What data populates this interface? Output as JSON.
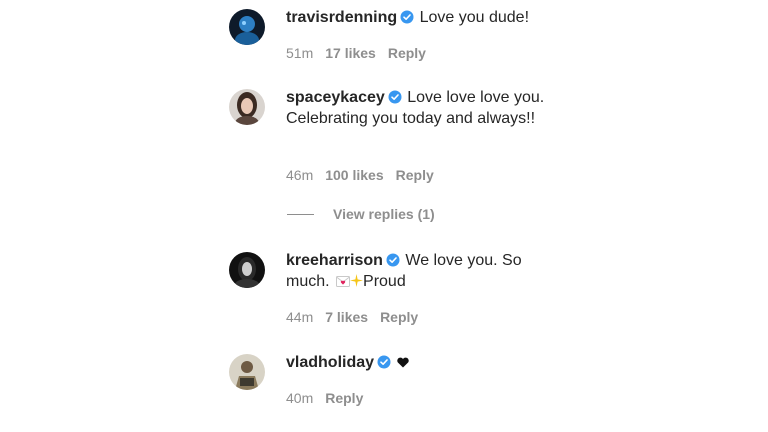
{
  "comments": [
    {
      "username": "travisrdenning",
      "text": "Love you dude!",
      "time": "51m",
      "likes": "17 likes",
      "reply": "Reply"
    },
    {
      "username": "spaceykacey",
      "text": "Love love love you. Celebrating you today and always!!",
      "time": "46m",
      "likes": "100 likes",
      "reply": "Reply"
    },
    {
      "username": "kreeharrison",
      "text_before": "We love you. So much.",
      "emoji": "💌✨",
      "text_after": "Proud",
      "time": "44m",
      "likes": "7 likes",
      "reply": "Reply"
    },
    {
      "username": "vladholiday",
      "emoji": "🖤",
      "time": "40m",
      "reply": "Reply"
    }
  ],
  "view_replies": "View replies (1)",
  "icons": {
    "verified": "verified-badge-icon",
    "black_heart": "black-heart-icon",
    "love_letter": "love-letter-icon",
    "sparkles": "sparkles-icon"
  },
  "colors": {
    "text": "#262626",
    "secondary": "#8e8e8e",
    "verified": "#3897f0"
  }
}
